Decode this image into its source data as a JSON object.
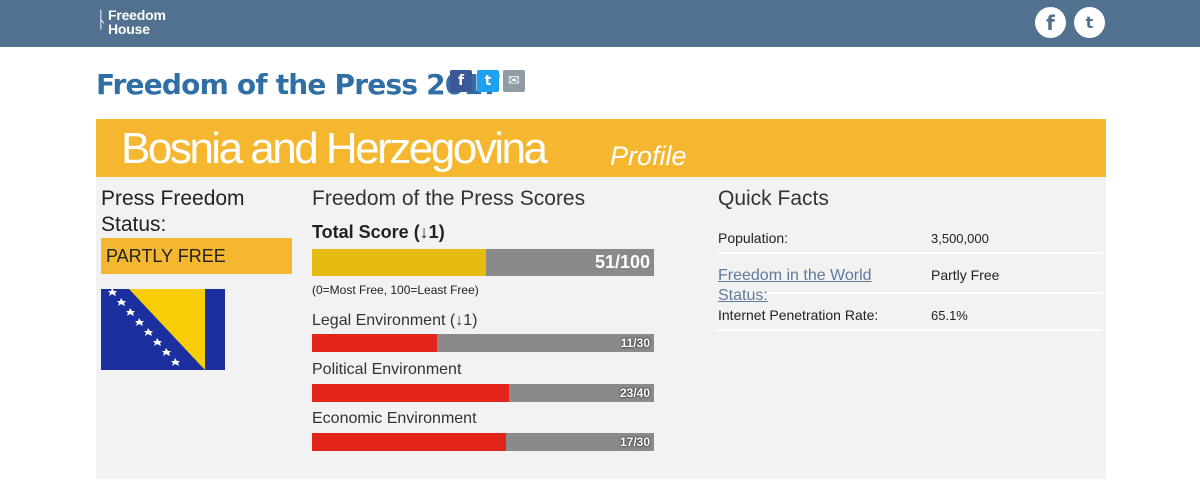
{
  "header": {
    "logo_line1": "Freedom",
    "logo_line2": "House",
    "social_top": [
      "f",
      "t"
    ]
  },
  "page": {
    "title": "Freedom of the Press 2017",
    "share_icons": [
      "f",
      "t",
      "✉"
    ]
  },
  "banner": {
    "country": "Bosnia and Herzegovina",
    "subtitle": "Profile"
  },
  "status": {
    "heading": "Press Freedom Status:",
    "value": "PARTLY FREE",
    "color": "#f5b72f"
  },
  "scores": {
    "heading": "Freedom of the Press Scores",
    "total": {
      "label": "Total Score (↓1)",
      "value_text": "51/100",
      "fraction": 0.51,
      "color": "#e6bb0f"
    },
    "note": "(0=Most Free, 100=Least Free)",
    "components": [
      {
        "label": "Legal Environment (↓1)",
        "value_text": "11/30",
        "fraction": 0.3667
      },
      {
        "label": "Political Environment",
        "value_text": "23/40",
        "fraction": 0.575
      },
      {
        "label": "Economic Environment",
        "value_text": "17/30",
        "fraction": 0.5667
      }
    ],
    "component_color": "#e3241b"
  },
  "quick_facts": {
    "heading": "Quick Facts",
    "population_label": "Population:",
    "population_value": "3,500,000",
    "fitw_label": "Freedom in the World Status:",
    "fitw_value": "Partly Free",
    "internet_label": "Internet Penetration Rate:",
    "internet_value": "65.1%"
  },
  "colors": {
    "topbar": "#52708f",
    "banner": "#f5b72f",
    "title": "#2f6fa5"
  }
}
